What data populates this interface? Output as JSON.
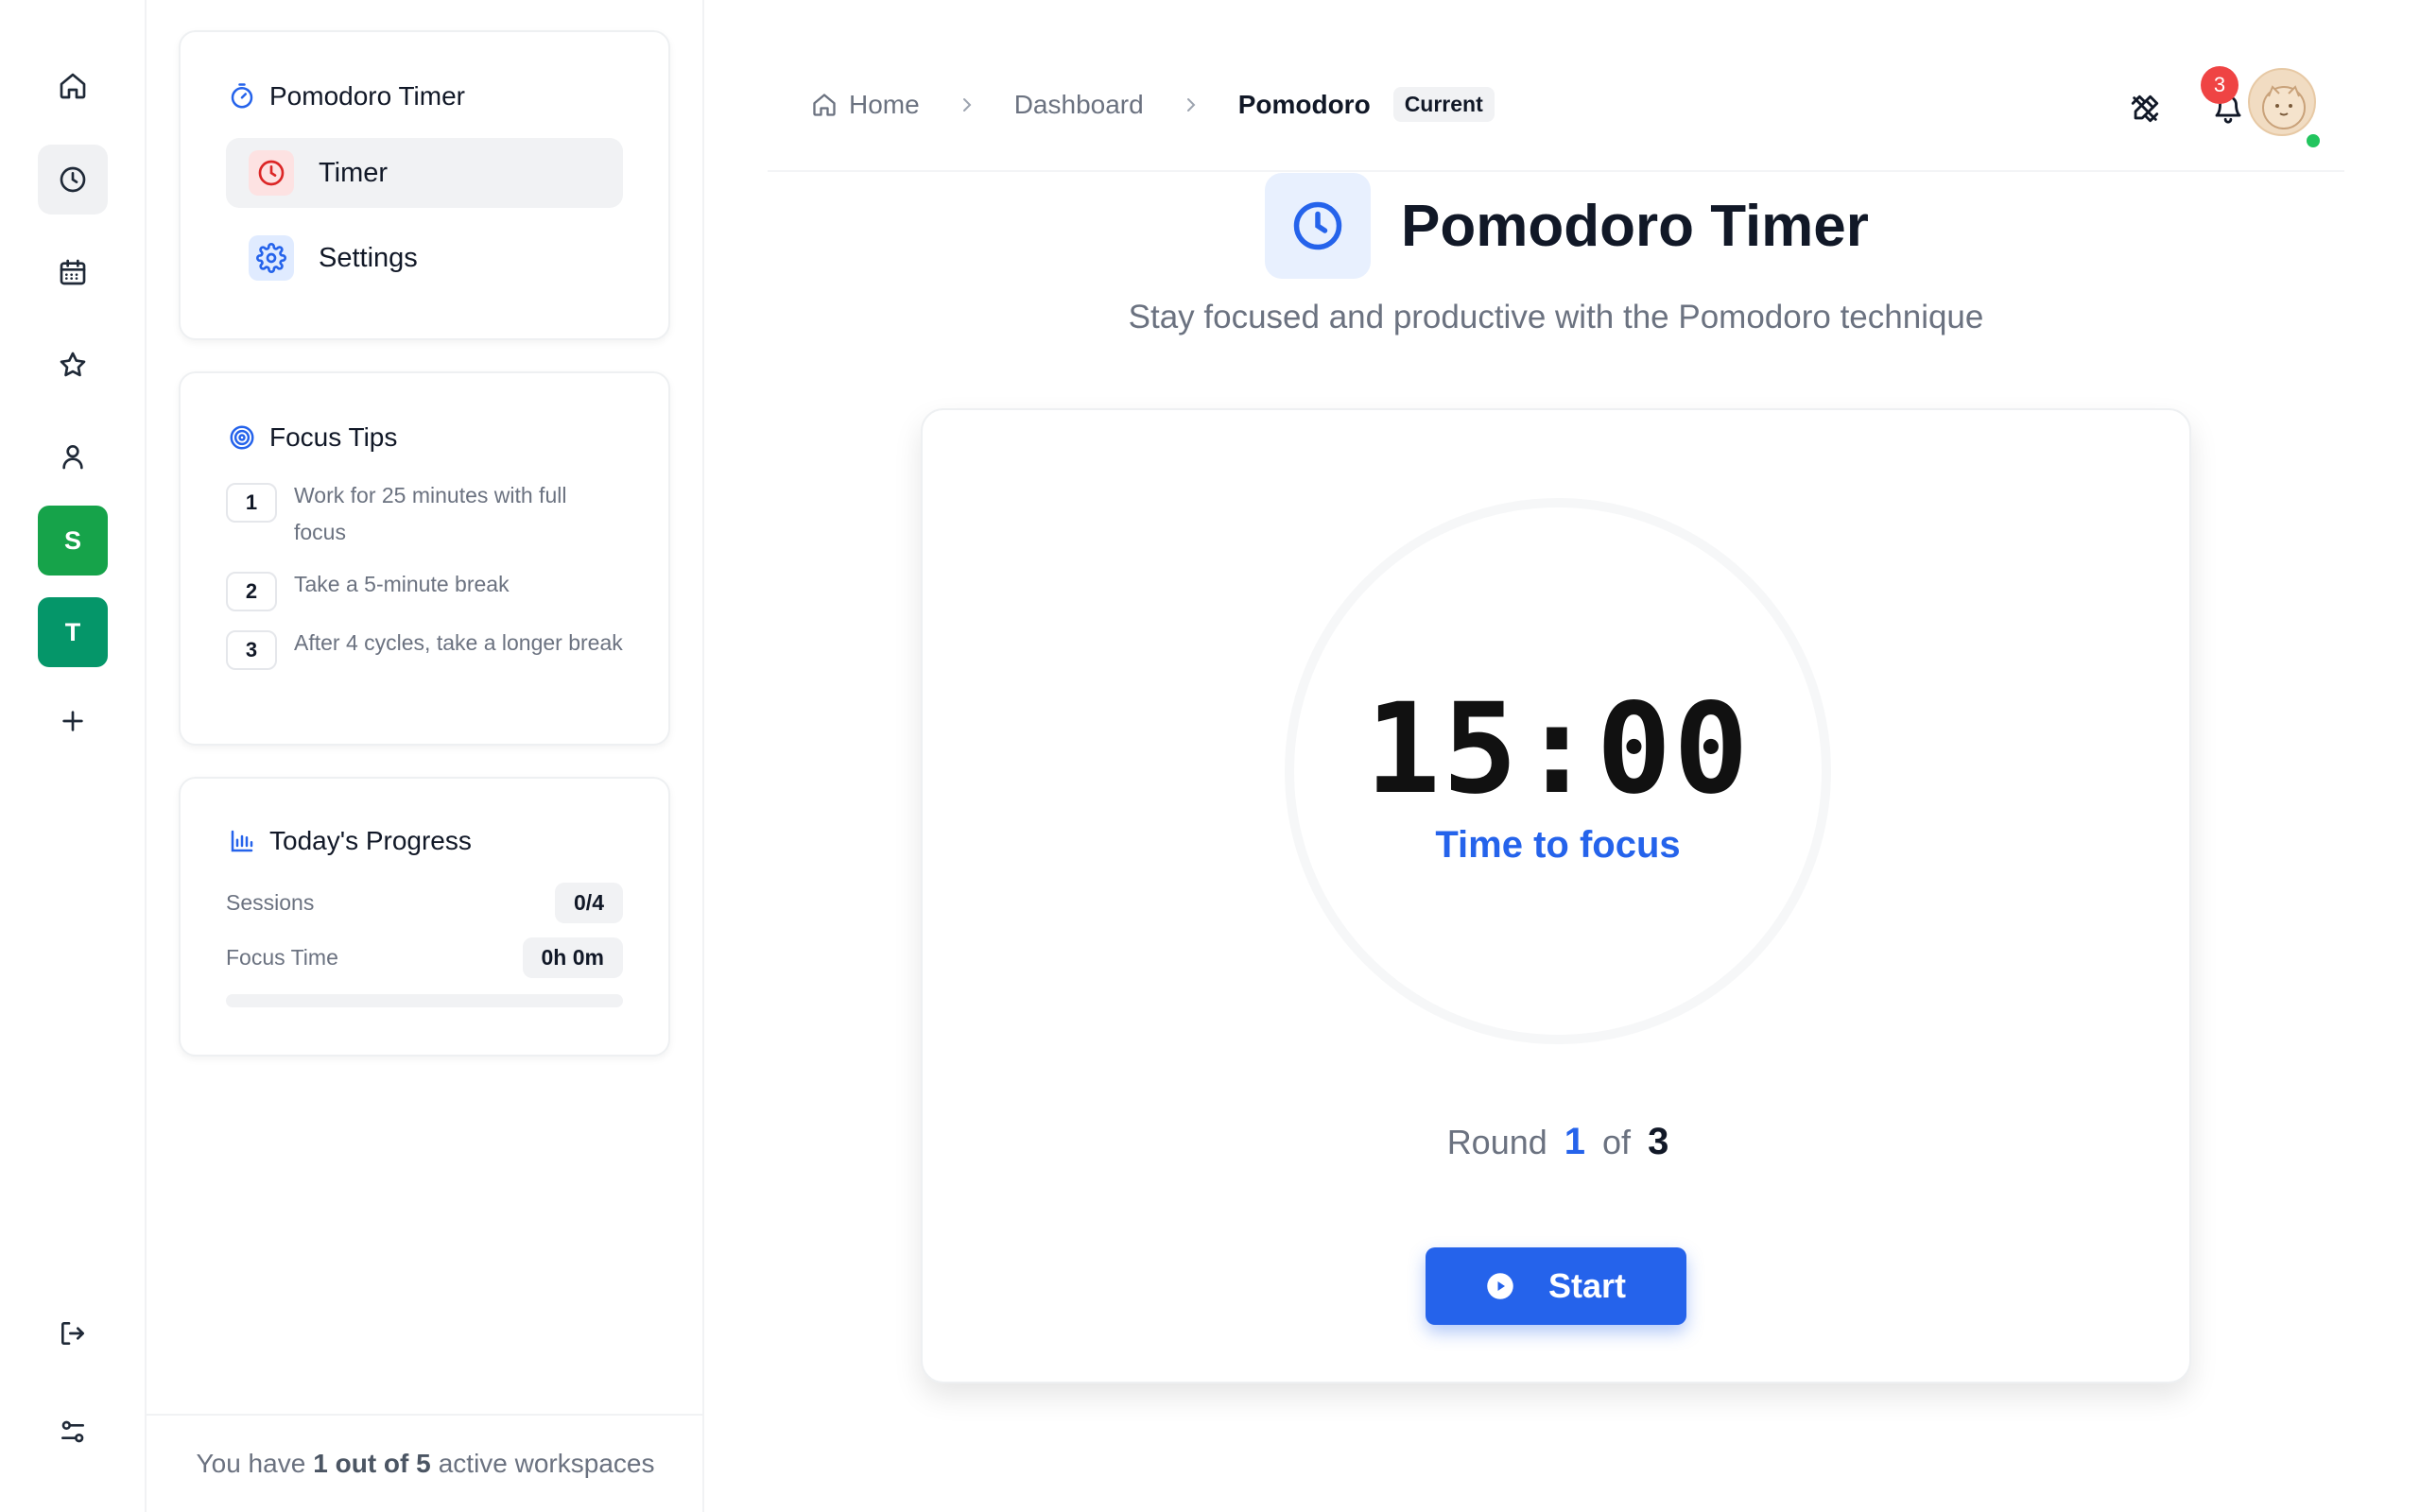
{
  "sidebar_nav": {
    "card_title": "Pomodoro Timer",
    "items": [
      {
        "label": "Timer",
        "icon": "clock-icon",
        "active": true
      },
      {
        "label": "Settings",
        "icon": "gear-icon",
        "active": false
      }
    ]
  },
  "focus_tips": {
    "title": "Focus Tips",
    "tips": [
      {
        "num": "1",
        "text": "Work for 25 minutes with full focus"
      },
      {
        "num": "2",
        "text": "Take a 5-minute break"
      },
      {
        "num": "3",
        "text": "After 4 cycles, take a longer break"
      }
    ]
  },
  "progress": {
    "title": "Today's Progress",
    "sessions_label": "Sessions",
    "sessions_value": "0/4",
    "focus_label": "Focus Time",
    "focus_value": "0h 0m",
    "fraction": 0
  },
  "workspaces": {
    "letters": [
      "S",
      "T"
    ],
    "colors": [
      "#16a34a",
      "#059669"
    ],
    "footer_prefix": "You have",
    "footer_count": "1 out of 5",
    "footer_suffix": "active workspaces"
  },
  "breadcrumb": {
    "home": "Home",
    "dashboard": "Dashboard",
    "current": "Pomodoro",
    "current_badge": "Current"
  },
  "header": {
    "notification_count": "3"
  },
  "main": {
    "title": "Pomodoro Timer",
    "subtitle": "Stay focused and productive with the Pomodoro technique",
    "time": "15:00",
    "mode": "Time to focus",
    "round_label": "Round",
    "round_current": "1",
    "round_of": "of",
    "round_total": "3",
    "start_label": "Start"
  },
  "colors": {
    "accent": "#2563eb",
    "danger": "#ef4444",
    "online": "#22c55e"
  }
}
